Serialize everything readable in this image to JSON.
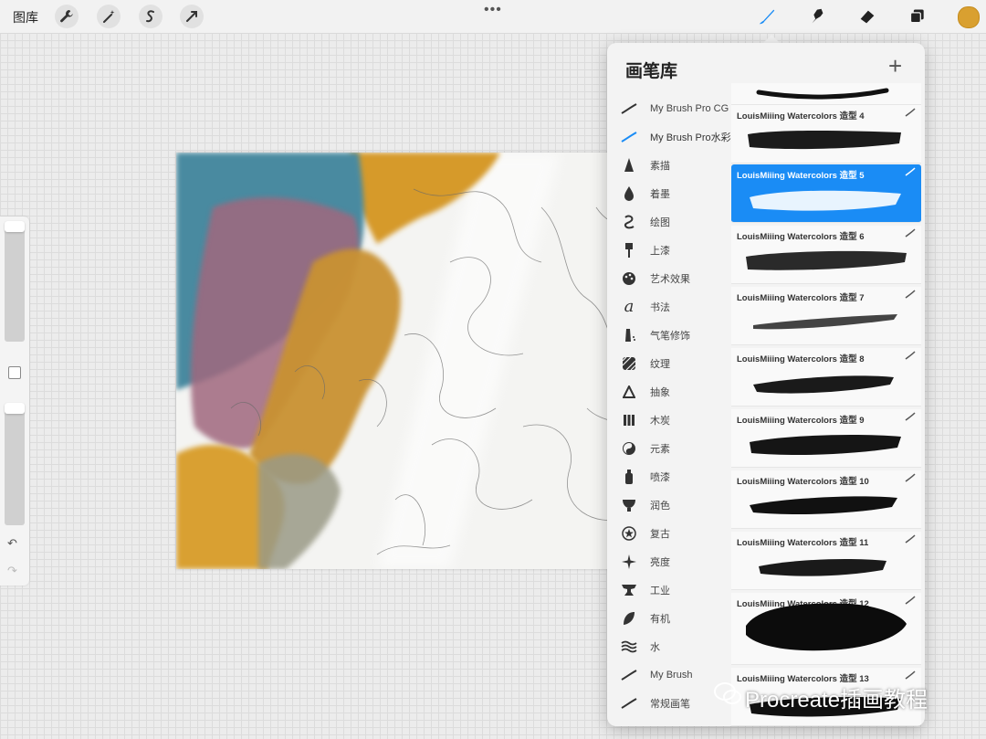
{
  "topbar": {
    "gallery_label": "图库",
    "more_dots": "•••",
    "tools_left": [
      "wrench-icon",
      "magic-wand-icon",
      "selection-icon",
      "transform-icon"
    ],
    "tools_right": [
      "brush-icon",
      "smudge-icon",
      "eraser-icon",
      "layers-icon"
    ],
    "current_color": "#d9a030",
    "accent": "#1a8cf5"
  },
  "sidebar": {
    "undo_glyph": "↶",
    "redo_glyph": "↷"
  },
  "panel": {
    "title": "画笔库",
    "add_glyph": "+",
    "categories": [
      {
        "label": "My Brush Pro CG",
        "icon": "stroke-icon",
        "selected": false
      },
      {
        "label": "My Brush Pro水彩",
        "icon": "stroke-icon",
        "selected": true
      },
      {
        "label": "素描",
        "icon": "pencil-tip-icon"
      },
      {
        "label": "着墨",
        "icon": "ink-drop-icon"
      },
      {
        "label": "绘图",
        "icon": "swirl-icon"
      },
      {
        "label": "上漆",
        "icon": "paint-brush-icon"
      },
      {
        "label": "艺术效果",
        "icon": "palette-icon"
      },
      {
        "label": "书法",
        "icon": "calligraphy-icon"
      },
      {
        "label": "气笔修饰",
        "icon": "airbrush-icon"
      },
      {
        "label": "纹理",
        "icon": "texture-icon"
      },
      {
        "label": "抽象",
        "icon": "triangle-icon"
      },
      {
        "label": "木炭",
        "icon": "charcoal-icon"
      },
      {
        "label": "元素",
        "icon": "yin-yang-icon"
      },
      {
        "label": "喷漆",
        "icon": "spray-can-icon"
      },
      {
        "label": "润色",
        "icon": "blender-icon"
      },
      {
        "label": "复古",
        "icon": "retro-star-icon"
      },
      {
        "label": "亮度",
        "icon": "sparkle-icon"
      },
      {
        "label": "工业",
        "icon": "anvil-icon"
      },
      {
        "label": "有机",
        "icon": "leaf-icon"
      },
      {
        "label": "水",
        "icon": "waves-icon"
      },
      {
        "label": "My Brush",
        "icon": "stroke-icon"
      },
      {
        "label": "常规画笔",
        "icon": "stroke-icon"
      }
    ],
    "brushes": [
      {
        "name": "",
        "selected": false
      },
      {
        "name": "LouisMiiing Watercolors 造型 4",
        "selected": false
      },
      {
        "name": "LouisMiiing Watercolors 造型 5",
        "selected": true
      },
      {
        "name": "LouisMiiing Watercolors 造型 6",
        "selected": false
      },
      {
        "name": "LouisMiiing Watercolors 造型 7",
        "selected": false
      },
      {
        "name": "LouisMiiing Watercolors 造型 8",
        "selected": false
      },
      {
        "name": "LouisMiiing Watercolors 造型 9",
        "selected": false
      },
      {
        "name": "LouisMiiing Watercolors 造型 10",
        "selected": false
      },
      {
        "name": "LouisMiiing Watercolors 造型 11",
        "selected": false
      },
      {
        "name": "LouisMiiing Watercolors 造型 12",
        "selected": false
      },
      {
        "name": "LouisMiiing Watercolors 造型 13",
        "selected": false
      }
    ]
  },
  "watermark": "Procreate插画教程"
}
